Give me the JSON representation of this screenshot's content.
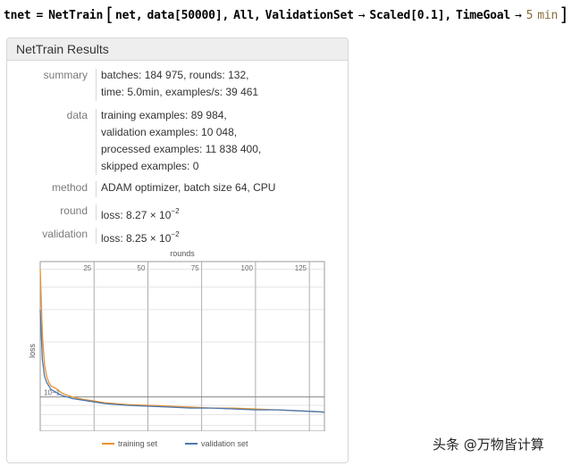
{
  "input": {
    "var": "tnet",
    "eq": "=",
    "func": "NetTrain",
    "arg1": "net",
    "arg2": "data[50000]",
    "arg3": "All",
    "opt1_name": "ValidationSet",
    "opt1_value": "Scaled[0.1]",
    "opt2_name": "TimeGoal",
    "opt2_num": "5",
    "opt2_unit": "min",
    "arrow": "→",
    "comma": ","
  },
  "panel": {
    "title": "NetTrain Results",
    "rows": {
      "summary": {
        "key": "summary",
        "lines": [
          "batches: 184 975, rounds: 132,",
          "time: 5.0min, examples/s: 39 461"
        ]
      },
      "data": {
        "key": "data",
        "lines": [
          "training examples: 89 984,",
          "validation examples: 10 048,",
          "processed examples: 11 838 400,",
          "skipped examples: 0"
        ]
      },
      "method": {
        "key": "method",
        "lines": [
          "ADAM optimizer, batch size 64, CPU"
        ]
      },
      "round": {
        "key": "round",
        "prefix": "loss: 8.27 × 10",
        "exp": "−2"
      },
      "validation": {
        "key": "validation",
        "prefix": "loss: 8.25 × 10",
        "exp": "−2"
      }
    }
  },
  "chart_data": {
    "type": "line",
    "title": "rounds",
    "xlabel": "rounds",
    "ylabel": "loss",
    "xlim": [
      0,
      132
    ],
    "x_ticks": [
      25,
      50,
      75,
      100,
      125
    ],
    "y_tick_labels": [
      "10−1"
    ],
    "y_scale": "log",
    "grid": true,
    "legend_position": "bottom",
    "colors": {
      "training": "#e8922e",
      "validation": "#4a78b0",
      "grid": "#cccccc",
      "frame": "#999999"
    },
    "series": [
      {
        "name": "training set",
        "color": "#e8922e",
        "x": [
          0,
          1,
          2,
          3,
          4,
          5,
          8,
          10,
          15,
          20,
          25,
          30,
          40,
          50,
          60,
          70,
          80,
          90,
          100,
          110,
          120,
          130,
          132
        ],
        "y": [
          0.5,
          0.22,
          0.15,
          0.13,
          0.12,
          0.115,
          0.11,
          0.105,
          0.1,
          0.097,
          0.095,
          0.093,
          0.091,
          0.09,
          0.089,
          0.088,
          0.087,
          0.087,
          0.086,
          0.085,
          0.084,
          0.083,
          0.0827
        ]
      },
      {
        "name": "validation set",
        "color": "#4a78b0",
        "x": [
          0,
          1,
          2,
          3,
          4,
          5,
          8,
          10,
          15,
          20,
          25,
          30,
          40,
          50,
          60,
          70,
          80,
          90,
          100,
          110,
          120,
          130,
          132
        ],
        "y": [
          0.3,
          0.16,
          0.13,
          0.12,
          0.115,
          0.11,
          0.105,
          0.102,
          0.098,
          0.096,
          0.094,
          0.092,
          0.09,
          0.089,
          0.088,
          0.087,
          0.087,
          0.086,
          0.085,
          0.085,
          0.084,
          0.083,
          0.0825
        ]
      }
    ]
  },
  "watermark": "头条 @万物皆计算"
}
